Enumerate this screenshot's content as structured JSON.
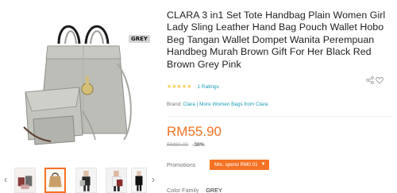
{
  "gallery": {
    "tag_label": "GREY",
    "prev_arrow": "‹",
    "next_arrow": "›",
    "thumbnails": [
      "thumb-1",
      "thumb-2",
      "thumb-3",
      "thumb-4",
      "thumb-5"
    ],
    "active_thumb": 2
  },
  "product": {
    "title": "CLARA 3 in1 Set Tote Handbag Plain Women Girl Lady Sling Leather Hand Bag Pouch Wallet Hobo Beg Tangan Wallet Dompet Wanita Perempuan Handbeg Murah Brown Gift For Her Black Red Brown Grey Pink",
    "stars": "★★★★★",
    "ratings_text": "1 Ratings",
    "brand_label": "Brand:",
    "brand_name": "Clara",
    "brand_separator": "|",
    "more_link": "More Women Bags from Clara",
    "price": "RM55.90",
    "old_price": "RM90.00",
    "discount": "-38%",
    "promotions_label": "Promotions",
    "promo_badge": "Min. spend RM0.01",
    "promo_caret": "▼",
    "color_label": "Color Family",
    "color_value": "GREY"
  },
  "colors": {
    "accent": "#f57224",
    "link": "#1a9cb7",
    "star": "#faca51",
    "bag_grey": "#b9b9b4"
  },
  "icons": {
    "share": "share-icon",
    "wishlist": "heart-icon"
  }
}
